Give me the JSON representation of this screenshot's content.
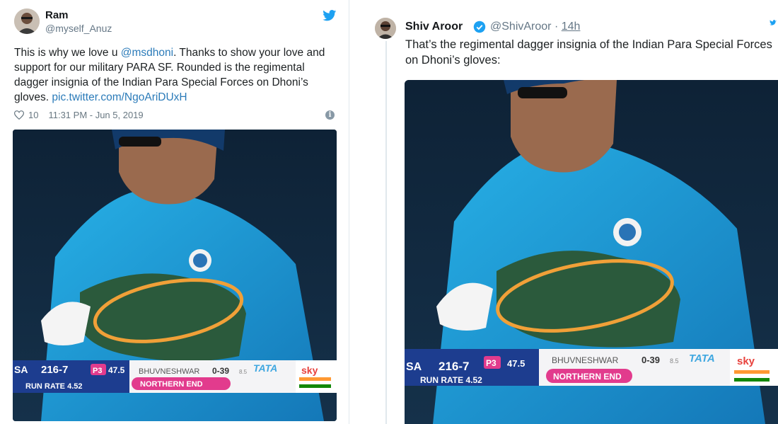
{
  "left_tweet": {
    "name": "Ram",
    "handle": "@myself_Anuz",
    "text_before": "This is why we love u ",
    "mention": "@msdhoni",
    "text_after": ". Thanks to show your love and support for our military PARA SF. Rounded is the regimental dagger insignia of the Indian Para Special Forces on Dhoni’s gloves. ",
    "pic_link": "pic.twitter.com/NgoAriDUxH",
    "likes": "10",
    "timestamp": "11:31 PM - Jun 5, 2019",
    "media_scorebar": {
      "team": "SA",
      "score": "216-7",
      "powerplay": "P3",
      "overs": "47.5",
      "run_rate": "RUN RATE 4.52",
      "bowler": "BHUVNESHWAR",
      "bowler_figures": "0-39",
      "bowler_overs": "8.5",
      "sponsor": "TATA",
      "end": "NORTHERN END",
      "broadcaster": "sky"
    }
  },
  "right_tweet": {
    "name": "Shiv Aroor",
    "handle": "@ShivAroor",
    "separator": "·",
    "time": "14h",
    "text": "That’s the regimental dagger insignia of the Indian Para Special Forces on Dhoni’s gloves:",
    "media_scorebar": {
      "team": "SA",
      "score": "216-7",
      "powerplay": "P3",
      "overs": "47.5",
      "run_rate": "RUN RATE 4.52",
      "bowler": "BHUVNESHWAR",
      "bowler_figures": "0-39",
      "bowler_overs": "8.5",
      "sponsor": "TATA",
      "end": "NORTHERN END",
      "broadcaster": "sky"
    }
  },
  "colors": {
    "twitter_blue": "#1da1f2",
    "link": "#2b7bb9",
    "circle_orange": "#f0a038",
    "jersey": "#1e9fd8",
    "glove_green": "#2b5a3c"
  },
  "icons": {
    "bird": "twitter-bird-icon",
    "heart": "heart-icon",
    "info": "info-icon",
    "verified": "verified-badge-icon"
  }
}
